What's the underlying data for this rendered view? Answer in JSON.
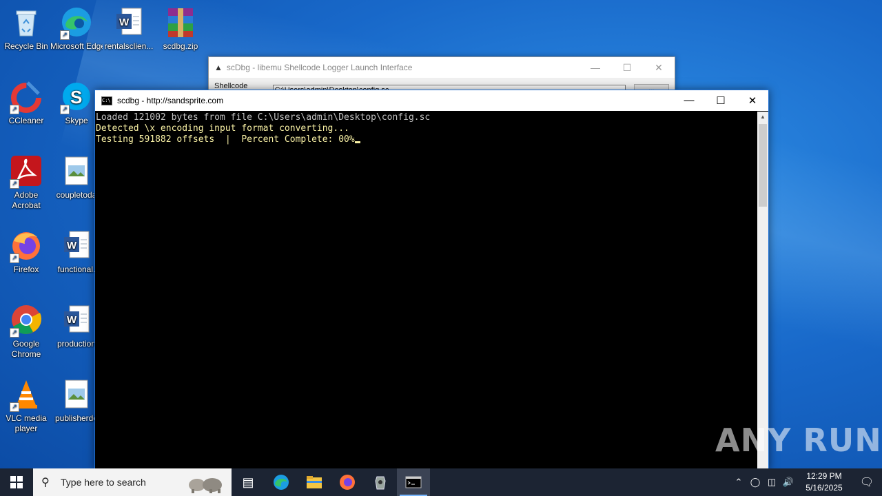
{
  "desktop": {
    "icons": [
      {
        "label": "Recycle Bin",
        "icon": "recycle-bin-icon"
      },
      {
        "label": "Microsoft Edge",
        "icon": "edge-icon"
      },
      {
        "label": "rentalsclien...",
        "icon": "word-doc-icon"
      },
      {
        "label": "scdbg.zip",
        "icon": "winrar-archive-icon"
      },
      {
        "label": "CCleaner",
        "icon": "ccleaner-icon"
      },
      {
        "label": "Skype",
        "icon": "skype-icon"
      },
      {
        "label": "Adobe Acrobat",
        "icon": "acrobat-icon"
      },
      {
        "label": "coupletoda",
        "icon": "image-file-icon"
      },
      {
        "label": "Firefox",
        "icon": "firefox-icon"
      },
      {
        "label": "functional.",
        "icon": "word-doc-icon"
      },
      {
        "label": "Google Chrome",
        "icon": "chrome-icon"
      },
      {
        "label": "production",
        "icon": "word-doc-icon"
      },
      {
        "label": "VLC media player",
        "icon": "vlc-icon"
      },
      {
        "label": "publisherde",
        "icon": "image-file-icon"
      }
    ]
  },
  "launcher": {
    "title": "scDbg - libemu Shellcode Logger Launch Interface",
    "shellcode_label": "Shellcode file",
    "shellcode_path": "C:\\Users\\admin\\Desktop\\config.sc",
    "browse_label": "..."
  },
  "console": {
    "title": "scdbg - http://sandsprite.com",
    "lines": [
      "Loaded 121002 bytes from file C:\\Users\\admin\\Desktop\\config.sc",
      "Detected \\x encoding input format converting...",
      "Testing 591882 offsets  |  Percent Complete: 00%"
    ]
  },
  "watermark": "ANY RUN",
  "taskbar": {
    "search_placeholder": "Type here to search",
    "time": "12:29 PM",
    "date": "5/16/2025",
    "apps": [
      "task-view-icon",
      "edge-icon",
      "file-explorer-icon",
      "firefox-icon",
      "scdbg-icon",
      "cmd-icon"
    ]
  },
  "colors": {
    "console_text": "#c0c0c0",
    "console_highlight": "#f9f1a5",
    "taskbar": "#1c2433"
  }
}
